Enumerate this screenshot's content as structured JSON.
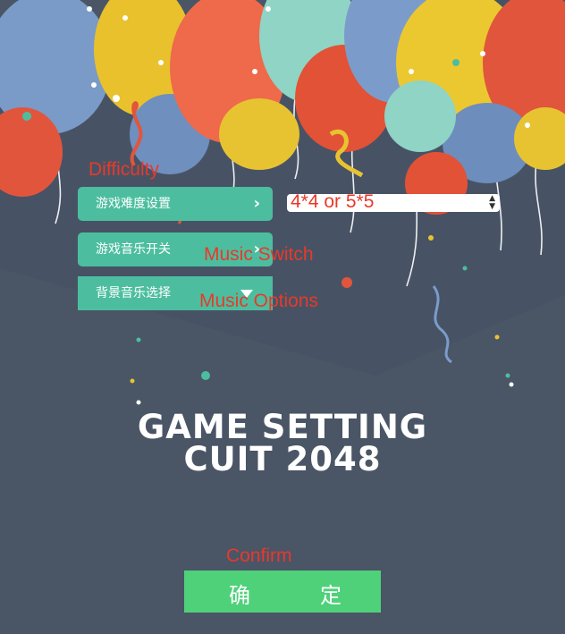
{
  "menu": {
    "difficulty_label": "游戏难度设置",
    "music_switch_label": "游戏音乐开关",
    "music_select_label": "背景音乐选择"
  },
  "annotations": {
    "difficulty": "Difficulty",
    "music_switch": "Music Switch",
    "music_options": "Music Options",
    "confirm": "Confirm"
  },
  "size_select": {
    "selected": "4*4 or 5*5"
  },
  "title": {
    "line1": "GAME SETTING",
    "line2": "CUIT 2048"
  },
  "confirm_button": {
    "char1": "确",
    "char2": "定"
  },
  "colors": {
    "background": "#4a5566",
    "menu_button": "#4cbe9f",
    "confirm_button": "#4fd17a",
    "annotation": "#e8392b"
  }
}
